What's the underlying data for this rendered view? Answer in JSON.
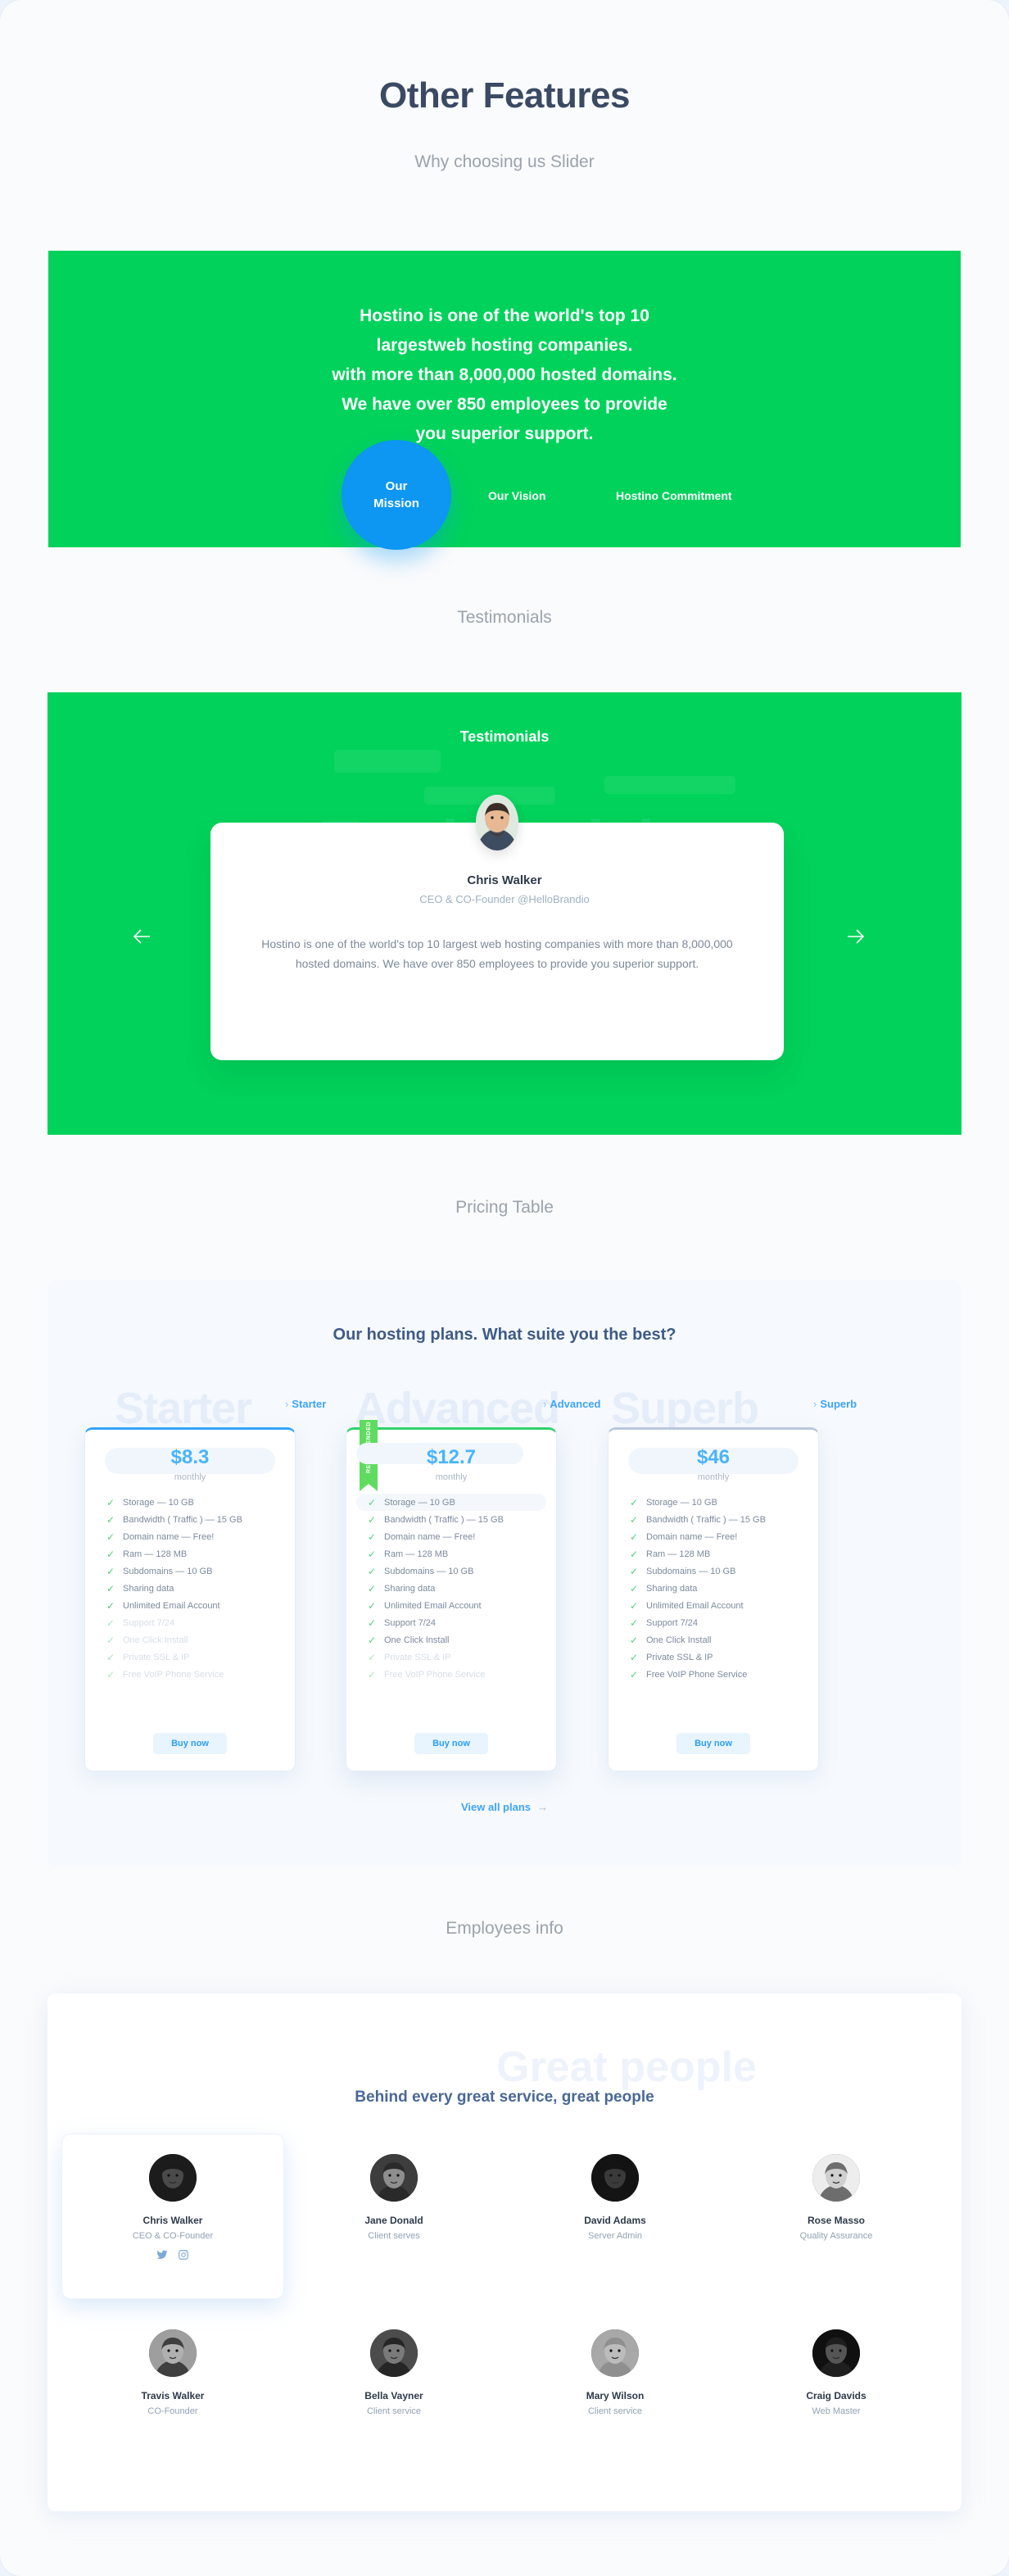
{
  "hero": {
    "title": "Other Features",
    "subtitle": "Why choosing us Slider"
  },
  "feature_slider": {
    "body_lines": [
      "Hostino is one of the world's top 10",
      "largestweb hosting companies.",
      "with more than 8,000,000 hosted domains.",
      "We have over 850 employees to provide",
      "you superior support."
    ],
    "tabs": [
      {
        "label": "Our Mission",
        "active": true
      },
      {
        "label": "Our Vision",
        "active": false
      },
      {
        "label": "Hostino Commitment",
        "active": false
      }
    ],
    "bg_color": "#00d25b",
    "active_tab_color": "#0d96f2"
  },
  "testimonials": {
    "section_title": "Testimonials",
    "panel_title": "Testimonials",
    "watermark": "Testimonials",
    "name": "Chris Walker",
    "role": "CEO & CO-Founder @HelloBrandio",
    "quote": "Hostino is one of the world's top 10 largest web hosting companies with more than 8,000,000 hosted domains. We have over 850 employees to provide you superior support.",
    "prev_icon": "arrow-left-icon",
    "next_icon": "arrow-right-icon",
    "bg_color": "#00d25b"
  },
  "pricing": {
    "section_title": "Pricing Table",
    "panel_title": "Our hosting plans. What suite you the best?",
    "view_all_label": "View all plans",
    "view_all_arrow": "→",
    "ghost_names": [
      "Starter",
      "Advanced",
      "Superb"
    ],
    "chips": [
      "Starter",
      "Advanced",
      "Superb"
    ],
    "buy_label": "Buy now",
    "period": "monthly",
    "ribbon_label": "RECOMMENDED",
    "plans": [
      {
        "name": "Starter",
        "price": "$8.3",
        "period": "monthly",
        "accent": "#35a5f7",
        "recommended": false,
        "features": [
          {
            "text": "Storage — 10 GB",
            "enabled": true,
            "highlighted": false
          },
          {
            "text": "Bandwidth ( Traffic ) — 15 GB",
            "enabled": true,
            "highlighted": false
          },
          {
            "text": "Domain name — Free!",
            "enabled": true,
            "highlighted": false
          },
          {
            "text": "Ram — 128 MB",
            "enabled": true,
            "highlighted": false
          },
          {
            "text": "Subdomains — 10 GB",
            "enabled": true,
            "highlighted": false
          },
          {
            "text": "Sharing data",
            "enabled": true,
            "highlighted": false
          },
          {
            "text": "Unlimited Email Account",
            "enabled": true,
            "highlighted": false
          },
          {
            "text": "Support 7/24",
            "enabled": false,
            "highlighted": false
          },
          {
            "text": "One Click Install",
            "enabled": false,
            "highlighted": false
          },
          {
            "text": "Private  SSL & IP",
            "enabled": false,
            "highlighted": false
          },
          {
            "text": "Free VoIP Phone Service",
            "enabled": false,
            "highlighted": false
          }
        ]
      },
      {
        "name": "Advanced",
        "price": "$12.7",
        "period": "monthly",
        "accent": "#2fd36a",
        "recommended": true,
        "features": [
          {
            "text": "Storage — 10 GB",
            "enabled": true,
            "highlighted": true
          },
          {
            "text": "Bandwidth ( Traffic ) — 15 GB",
            "enabled": true,
            "highlighted": false
          },
          {
            "text": "Domain name — Free!",
            "enabled": true,
            "highlighted": false
          },
          {
            "text": "Ram — 128 MB",
            "enabled": true,
            "highlighted": false
          },
          {
            "text": "Subdomains — 10 GB",
            "enabled": true,
            "highlighted": false
          },
          {
            "text": "Sharing data",
            "enabled": true,
            "highlighted": false
          },
          {
            "text": "Unlimited Email Account",
            "enabled": true,
            "highlighted": false
          },
          {
            "text": "Support 7/24",
            "enabled": true,
            "highlighted": false
          },
          {
            "text": "One Click Install",
            "enabled": true,
            "highlighted": false
          },
          {
            "text": "Private  SSL & IP",
            "enabled": false,
            "highlighted": false
          },
          {
            "text": "Free VoIP Phone Service",
            "enabled": false,
            "highlighted": false
          }
        ]
      },
      {
        "name": "Superb",
        "price": "$46",
        "period": "monthly",
        "accent": "#b9c7da",
        "recommended": false,
        "features": [
          {
            "text": "Storage — 10 GB",
            "enabled": true,
            "highlighted": false
          },
          {
            "text": "Bandwidth ( Traffic ) — 15 GB",
            "enabled": true,
            "highlighted": false
          },
          {
            "text": "Domain name — Free!",
            "enabled": true,
            "highlighted": false
          },
          {
            "text": "Ram — 128 MB",
            "enabled": true,
            "highlighted": false
          },
          {
            "text": "Subdomains — 10 GB",
            "enabled": true,
            "highlighted": false
          },
          {
            "text": "Sharing data",
            "enabled": true,
            "highlighted": false
          },
          {
            "text": "Unlimited Email Account",
            "enabled": true,
            "highlighted": false
          },
          {
            "text": "Support 7/24",
            "enabled": true,
            "highlighted": false
          },
          {
            "text": "One Click Install",
            "enabled": true,
            "highlighted": false
          },
          {
            "text": "Private  SSL & IP",
            "enabled": true,
            "highlighted": false
          },
          {
            "text": "Free VoIP Phone Service",
            "enabled": true,
            "highlighted": false
          }
        ]
      }
    ]
  },
  "employees": {
    "section_title": "Employees info",
    "watermark": "Great people",
    "panel_title": "Behind every great service, great people",
    "people": [
      {
        "name": "Chris Walker",
        "role": "CEO & CO-Founder",
        "featured": true,
        "socials": [
          "twitter-icon",
          "instagram-icon"
        ]
      },
      {
        "name": "Jane Donald",
        "role": "Client serves",
        "featured": false,
        "socials": []
      },
      {
        "name": "David Adams",
        "role": "Server Admin",
        "featured": false,
        "socials": []
      },
      {
        "name": "Rose Masso",
        "role": "Quality Assurance",
        "featured": false,
        "socials": []
      },
      {
        "name": "Travis Walker",
        "role": "CO-Founder",
        "featured": false,
        "socials": []
      },
      {
        "name": "Bella Vayner",
        "role": "Client service",
        "featured": false,
        "socials": []
      },
      {
        "name": "Mary Wilson",
        "role": "Client service",
        "featured": false,
        "socials": []
      },
      {
        "name": "Craig Davids",
        "role": "Web Master",
        "featured": false,
        "socials": []
      }
    ]
  }
}
